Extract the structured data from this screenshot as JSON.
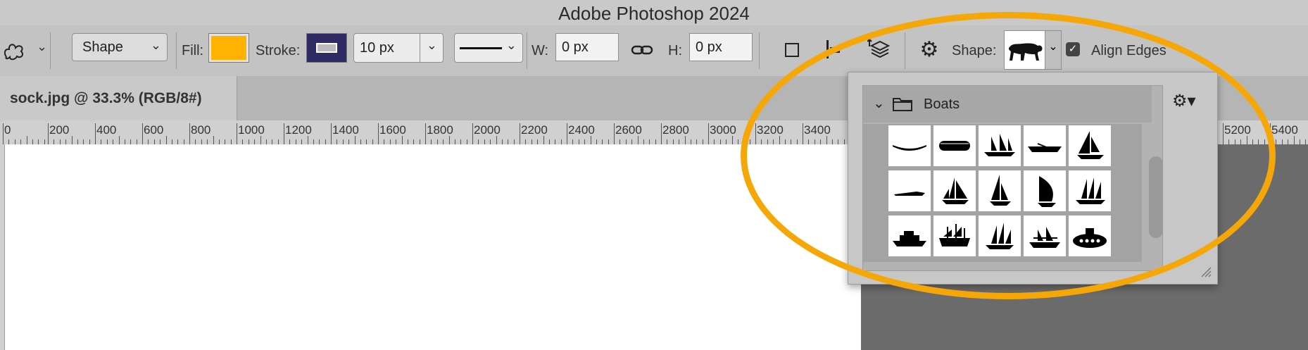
{
  "app": {
    "title": "Adobe Photoshop 2024"
  },
  "options_bar": {
    "tool_icon": "custom-shape-tool-icon",
    "mode": "Shape",
    "fill_label": "Fill:",
    "fill_color": "#FFB300",
    "stroke_label": "Stroke:",
    "stroke_color": "#2E2A63",
    "stroke_width": "10 px",
    "w_label": "W:",
    "w_value": "0 px",
    "h_label": "H:",
    "h_value": "0 px",
    "shape_label": "Shape:",
    "align_edges_label": "Align Edges",
    "align_edges_checked": true
  },
  "document": {
    "tab_title": "sock.jpg @ 33.3% (RGB/8#)"
  },
  "ruler": {
    "labels": [
      "0",
      "200",
      "400",
      "600",
      "800",
      "1000",
      "1200",
      "1400",
      "1600",
      "1800",
      "2000",
      "2200",
      "2400",
      "2600",
      "2800",
      "3000",
      "3200",
      "3400",
      "5200",
      "5400"
    ]
  },
  "shape_picker": {
    "folder_name": "Boats",
    "shapes": [
      "canoe-shape",
      "raft-shape",
      "sailing-ship-shape",
      "rowboat-shape",
      "sailboat-shape",
      "speedboat-shape",
      "schooner-shape",
      "yacht-sail-shape",
      "spinnaker-sail-shape",
      "tall-ship-shape",
      "cruise-ship-shape",
      "galleon-shape",
      "two-mast-schooner-shape",
      "pirate-ship-shape",
      "submarine-shape"
    ]
  },
  "highlight_color": "#F6A708"
}
